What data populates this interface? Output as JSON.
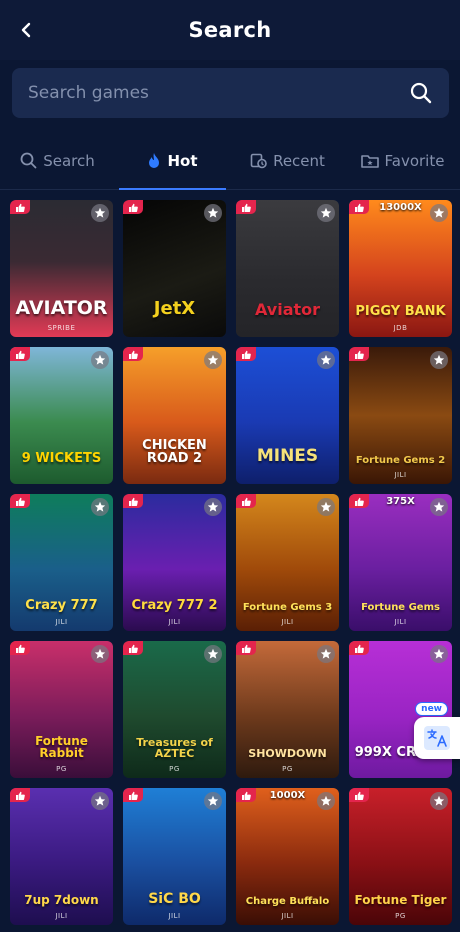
{
  "header": {
    "title": "Search"
  },
  "search": {
    "placeholder": "Search games",
    "value": ""
  },
  "tabs": [
    {
      "label": "Search",
      "icon": "search-icon",
      "active": false
    },
    {
      "label": "Hot",
      "icon": "flame-icon",
      "active": true
    },
    {
      "label": "Recent",
      "icon": "recent-icon",
      "active": false
    },
    {
      "label": "Favorite",
      "icon": "folder-star-icon",
      "active": false
    }
  ],
  "games": [
    {
      "name": "AVIATOR",
      "brand": "SPRIBE",
      "multiplier": ""
    },
    {
      "name": "JetX",
      "brand": "",
      "multiplier": ""
    },
    {
      "name": "Aviator",
      "brand": "",
      "multiplier": ""
    },
    {
      "name": "PIGGY BANK",
      "brand": "JDB",
      "multiplier": "13000X"
    },
    {
      "name": "9 WICKETS",
      "brand": "",
      "multiplier": ""
    },
    {
      "name": "CHICKEN ROAD 2",
      "brand": "",
      "multiplier": ""
    },
    {
      "name": "MINES",
      "brand": "",
      "multiplier": ""
    },
    {
      "name": "Fortune Gems 2",
      "brand": "JILI",
      "multiplier": ""
    },
    {
      "name": "Crazy 777",
      "brand": "JILI",
      "multiplier": ""
    },
    {
      "name": "Crazy 777 2",
      "brand": "JILI",
      "multiplier": ""
    },
    {
      "name": "Fortune Gems 3",
      "brand": "JILI",
      "multiplier": ""
    },
    {
      "name": "Fortune Gems",
      "brand": "JILI",
      "multiplier": "375X"
    },
    {
      "name": "Fortune Rabbit",
      "brand": "PG",
      "multiplier": ""
    },
    {
      "name": "Treasures of AZTEC",
      "brand": "PG",
      "multiplier": ""
    },
    {
      "name": "SHOWDOWN",
      "brand": "PG",
      "multiplier": ""
    },
    {
      "name": "999X CRASH",
      "brand": "",
      "multiplier": ""
    },
    {
      "name": "7up 7down",
      "brand": "JILI",
      "multiplier": ""
    },
    {
      "name": "SiC BO",
      "brand": "JILI",
      "multiplier": ""
    },
    {
      "name": "Charge Buffalo",
      "brand": "JILI",
      "multiplier": "1000X"
    },
    {
      "name": "Fortune Tiger",
      "brand": "PG",
      "multiplier": ""
    }
  ],
  "floating": {
    "new_label": "new"
  },
  "colors": {
    "background": "#0b1733",
    "accent": "#3b7bff",
    "like": "#e4254d"
  }
}
